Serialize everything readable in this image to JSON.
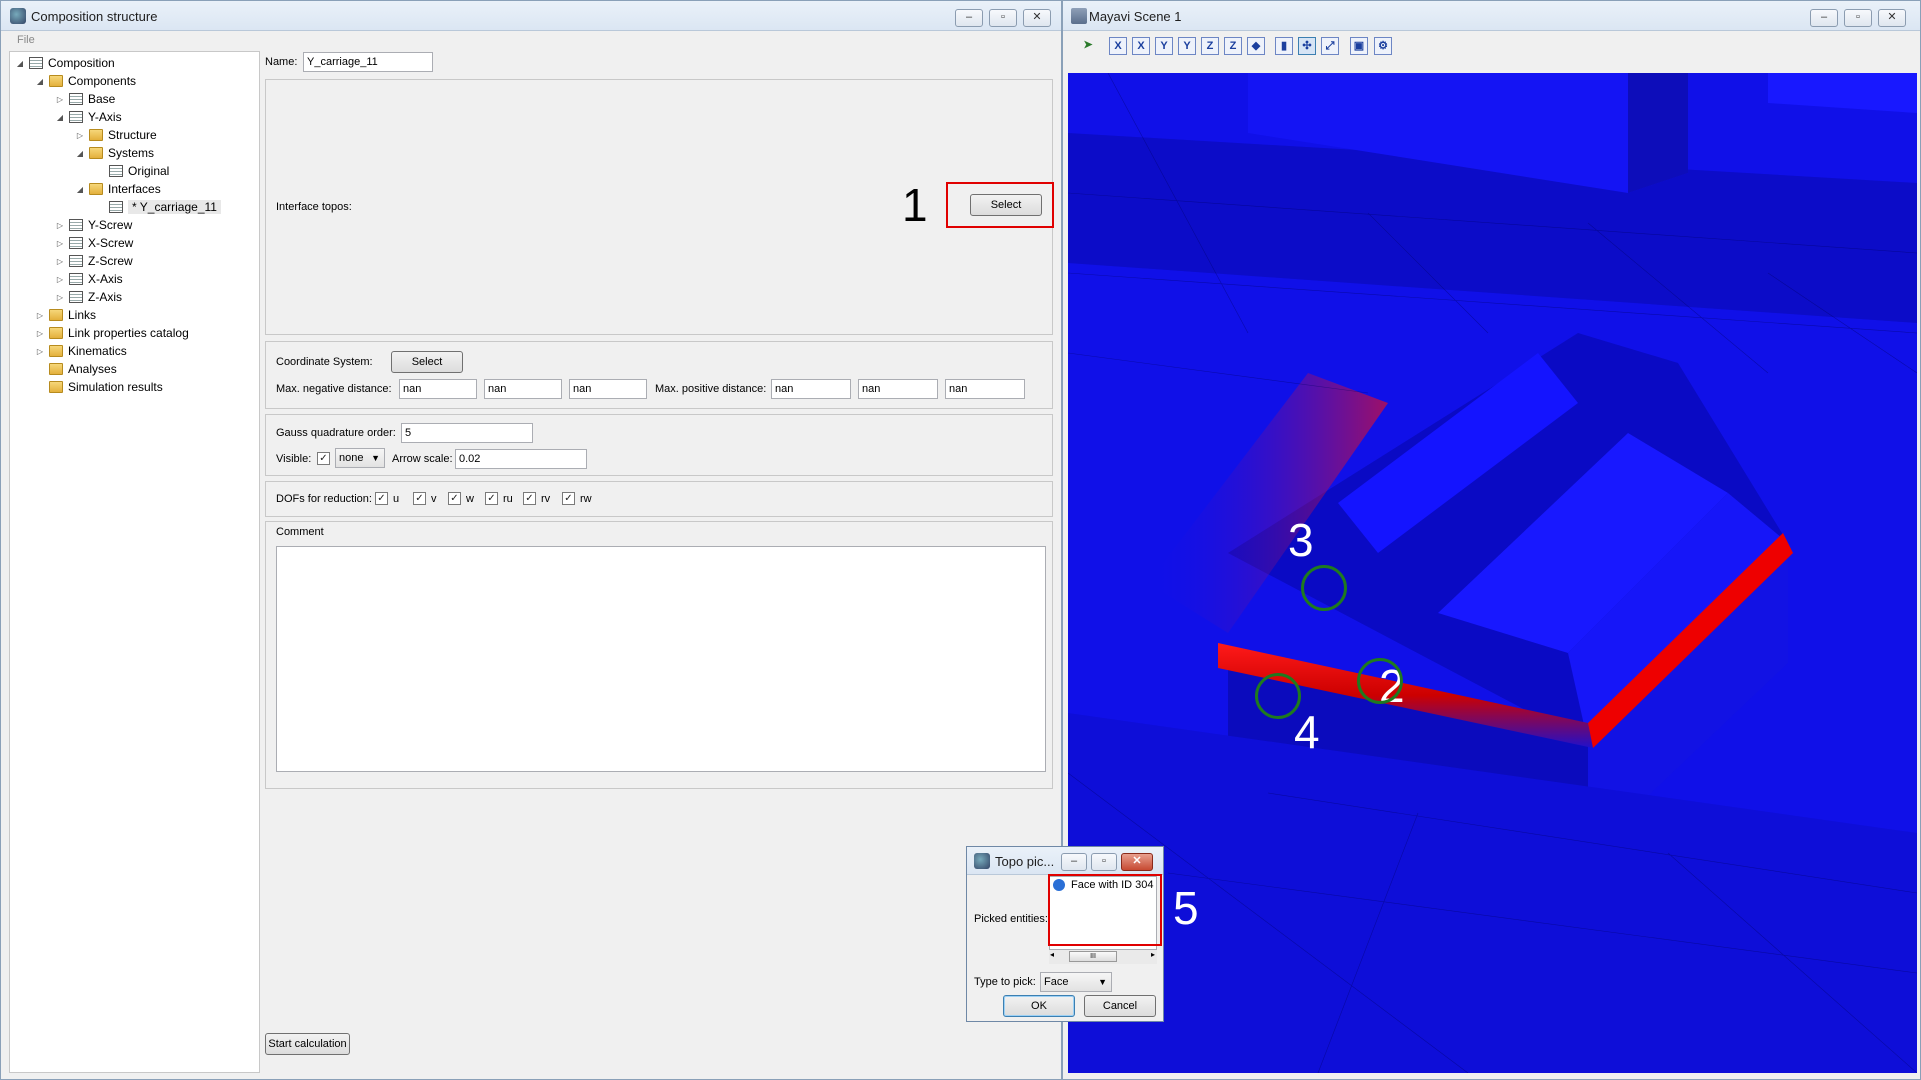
{
  "left_window": {
    "title": "Composition structure",
    "menu": [
      "File"
    ],
    "window_buttons": [
      "–",
      "▫",
      "✕"
    ],
    "tree": [
      {
        "label": "Composition",
        "depth": 0,
        "toggle": "◢",
        "icon": "doc"
      },
      {
        "label": "Components",
        "depth": 1,
        "toggle": "◢",
        "icon": "folder"
      },
      {
        "label": "Base",
        "depth": 2,
        "toggle": "▷",
        "icon": "doc"
      },
      {
        "label": "Y-Axis",
        "depth": 2,
        "toggle": "◢",
        "icon": "doc"
      },
      {
        "label": "Structure",
        "depth": 3,
        "toggle": "▷",
        "icon": "folder"
      },
      {
        "label": "Systems",
        "depth": 3,
        "toggle": "◢",
        "icon": "folder"
      },
      {
        "label": "Original",
        "depth": 4,
        "toggle": "",
        "icon": "doc"
      },
      {
        "label": "Interfaces",
        "depth": 3,
        "toggle": "◢",
        "icon": "folder"
      },
      {
        "label": "* Y_carriage_11",
        "depth": 4,
        "toggle": "",
        "icon": "doc",
        "selected": true
      },
      {
        "label": "Y-Screw",
        "depth": 2,
        "toggle": "▷",
        "icon": "doc"
      },
      {
        "label": "X-Screw",
        "depth": 2,
        "toggle": "▷",
        "icon": "doc"
      },
      {
        "label": "Z-Screw",
        "depth": 2,
        "toggle": "▷",
        "icon": "doc"
      },
      {
        "label": "X-Axis",
        "depth": 2,
        "toggle": "▷",
        "icon": "doc"
      },
      {
        "label": "Z-Axis",
        "depth": 2,
        "toggle": "▷",
        "icon": "doc"
      },
      {
        "label": "Links",
        "depth": 1,
        "toggle": "▷",
        "icon": "folder"
      },
      {
        "label": "Link properties catalog",
        "depth": 1,
        "toggle": "▷",
        "icon": "folder"
      },
      {
        "label": "Kinematics",
        "depth": 1,
        "toggle": "▷",
        "icon": "folder"
      },
      {
        "label": "Analyses",
        "depth": 1,
        "toggle": "",
        "icon": "folder"
      },
      {
        "label": "Simulation results",
        "depth": 1,
        "toggle": "",
        "icon": "folder"
      }
    ],
    "form": {
      "name_label": "Name:",
      "name_value": "Y_carriage_11",
      "interface_topos_label": "Interface topos:",
      "select_label": "Select",
      "coord_system_label": "Coordinate System:",
      "coord_select_label": "Select",
      "max_neg_label": "Max. negative distance:",
      "max_neg_values": [
        "nan",
        "nan",
        "nan"
      ],
      "max_pos_label": "Max. positive distance:",
      "max_pos_values": [
        "nan",
        "nan",
        "nan"
      ],
      "gauss_label": "Gauss quadrature order:",
      "gauss_value": "5",
      "visible_label": "Visible:",
      "visible_checked": "✓",
      "visible_dropdown": "none",
      "arrow_scale_label": "Arrow scale:",
      "arrow_scale_value": "0.02",
      "dofs_label": "DOFs for reduction:",
      "dofs": [
        {
          "label": "u",
          "check": "✓"
        },
        {
          "label": "v",
          "check": "✓"
        },
        {
          "label": "w",
          "check": "✓"
        },
        {
          "label": "ru",
          "check": "✓"
        },
        {
          "label": "rv",
          "check": "✓"
        },
        {
          "label": "rw",
          "check": "✓"
        }
      ],
      "comment_label": "Comment",
      "comment_value": "",
      "start_calc_label": "Start calculation"
    }
  },
  "right_window": {
    "title": "Mayavi Scene 1",
    "window_buttons": [
      "–",
      "▫",
      "✕"
    ],
    "toolbar_icons": [
      "pointer-icon",
      "x-view-icon",
      "x-view-neg-icon",
      "y-view-icon",
      "y-view-neg-icon",
      "z-view-icon",
      "z-view-neg-icon",
      "iso-view-icon",
      "parallel-projection-icon",
      "axes-indicator-icon",
      "fullscreen-icon",
      "save-icon",
      "settings-icon"
    ],
    "toolbar_glyphs": [
      "➤",
      "X",
      "X",
      "Y",
      "Y",
      "Z",
      "Z",
      "◆",
      "▮",
      "✣",
      "⤢",
      "▣",
      "⚙"
    ]
  },
  "annotations": [
    "1",
    "2",
    "3",
    "4",
    "5"
  ],
  "dialog": {
    "title": "Topo pic...",
    "window_buttons": [
      "–",
      "▫",
      "✕"
    ],
    "picked_label": "Picked entities:",
    "picked_items": [
      "Face with ID 304"
    ],
    "scroll_thumb": "III",
    "type_label": "Type to pick:",
    "type_value": "Face",
    "ok_label": "OK",
    "cancel_label": "Cancel"
  },
  "colors": {
    "scene_blue": "#1010ee",
    "highlight_red": "#ff0000",
    "marker_green": "#1f7a1f",
    "annotation_box": "#e00000"
  }
}
